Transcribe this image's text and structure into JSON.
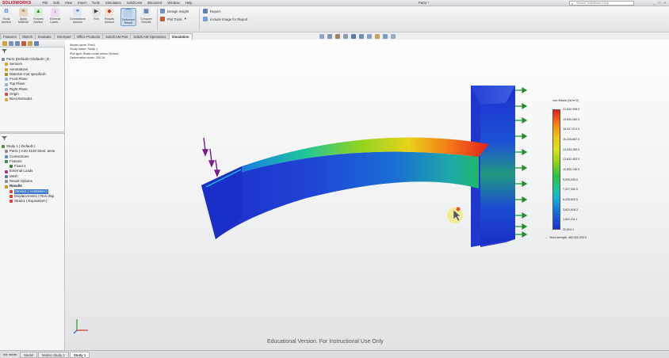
{
  "app": {
    "logo": "SOLIDWORKS",
    "menu": [
      "File",
      "Edit",
      "View",
      "Insert",
      "Tools",
      "Simulation",
      "SolidCAM",
      "3Dcontrol",
      "Window",
      "Help"
    ],
    "doc_title": "Part1 *",
    "help_search_placeholder": "Search SolidWorks Help",
    "window_controls": [
      "_",
      "□",
      "×"
    ]
  },
  "commands": [
    {
      "id": "study-advisor",
      "label": "Study\nAdvisor"
    },
    {
      "id": "apply-material",
      "label": "Apply\nMaterial"
    },
    {
      "id": "fixtures-advisor",
      "label": "Fixtures\nAdvisor"
    },
    {
      "id": "external-loads",
      "label": "External\nLoads..."
    },
    {
      "id": "connections-advisor",
      "label": "Connections\nAdvisor"
    },
    {
      "id": "run",
      "label": "Run"
    },
    {
      "id": "results-advisor",
      "label": "Results\nAdvisor"
    },
    {
      "id": "deformed-result",
      "label": "Deformed\nResult"
    },
    {
      "id": "compare-results",
      "label": "Compare\nResults"
    }
  ],
  "small_commands": {
    "design_insight": "Design Insight",
    "plot_tools": "Plot Tools",
    "report": "Report",
    "include_image": "Include Image for Report"
  },
  "tabs": [
    "Features",
    "Sketch",
    "Evaluate",
    "DimXpert",
    "Office Products",
    "SolidCAM Part",
    "SolidCAM Operations",
    "Simulation"
  ],
  "active_tab": "Simulation",
  "feature_tree": [
    {
      "label": "Part1 (Default<<Default>_D",
      "indent": 0,
      "color": "#7a8ca6"
    },
    {
      "label": "Sensors",
      "indent": 1,
      "color": "#d9a429"
    },
    {
      "label": "Annotations",
      "indent": 1,
      "color": "#d9a429"
    },
    {
      "label": "Material <not specified>",
      "indent": 1,
      "color": "#b9862f"
    },
    {
      "label": "Front Plane",
      "indent": 1,
      "color": "#9ab0cf"
    },
    {
      "label": "Top Plane",
      "indent": 1,
      "color": "#9ab0cf"
    },
    {
      "label": "Right Plane",
      "indent": 1,
      "color": "#9ab0cf"
    },
    {
      "label": "Origin",
      "indent": 1,
      "color": "#c94f3f"
    },
    {
      "label": "Boss-Extrude1",
      "indent": 1,
      "color": "#d7a63c"
    }
  ],
  "sim_tree": [
    {
      "label": "Study 1 (-Default-)",
      "indent": 0,
      "color": "#5d8d3c"
    },
    {
      "label": "Part1 (-AISI 4130 Steel, anne",
      "indent": 1,
      "color": "#8a8f96"
    },
    {
      "label": "Connections",
      "indent": 1,
      "color": "#5b8fc4"
    },
    {
      "label": "Fixtures",
      "indent": 1,
      "color": "#3f8a3f"
    },
    {
      "label": "Fixed-1",
      "indent": 2,
      "color": "#3f8a3f"
    },
    {
      "label": "External Loads",
      "indent": 1,
      "color": "#a8368e"
    },
    {
      "label": "Mesh",
      "indent": 1,
      "color": "#5e7ea8"
    },
    {
      "label": "Result Options",
      "indent": 1,
      "color": "#8e8e8e"
    },
    {
      "label": "Results",
      "indent": 1,
      "color": "#c99326",
      "bold": true
    },
    {
      "label": "Stress1 (-vonMises-)",
      "indent": 2,
      "color": "#d7432c",
      "selected": true
    },
    {
      "label": "Displacement1 (-Res disp",
      "indent": 2,
      "color": "#d7432c"
    },
    {
      "label": "Strain1 (-Equivalent-)",
      "indent": 2,
      "color": "#d7432c"
    }
  ],
  "study_info": [
    "Model name: Part1",
    "Study name: Study 1",
    "Plot type: Static nodal stress Stress1",
    "Deformation scale: 200.16"
  ],
  "legend": {
    "title": "von Mises (N/m^2)",
    "values": [
      "21,840,998.0",
      "19,839,280.0",
      "18,037,574.0",
      "16,235,867.0",
      "14,434,160.0",
      "12,632,453.0",
      "10,830,746.0",
      "9,029,039.0",
      "7,227,332.0",
      "6,425,625.0",
      "3,623,918.3",
      "1,822,211.1",
      "20,504.1"
    ],
    "yield": "Yield strength: 460,000,000.0",
    "gradient_colors": [
      "#e0211b",
      "#f57a17",
      "#f3c21a",
      "#d9e21d",
      "#8fd41f",
      "#2fc43a",
      "#1ec59b",
      "#1ab1d8",
      "#1572d9",
      "#1b2fd0"
    ]
  },
  "watermark": "Educational Version. For Instructional Use Only",
  "bottom_tabs": [
    "Model",
    "Motion Study 1",
    "Study 1"
  ],
  "active_bottom_tab": "Study 1",
  "colors": {
    "accent_red": "#c8102e",
    "selection_blue": "#3b78d0",
    "fixture_green": "#1f8f2a",
    "load_purple": "#7a1d8a"
  }
}
